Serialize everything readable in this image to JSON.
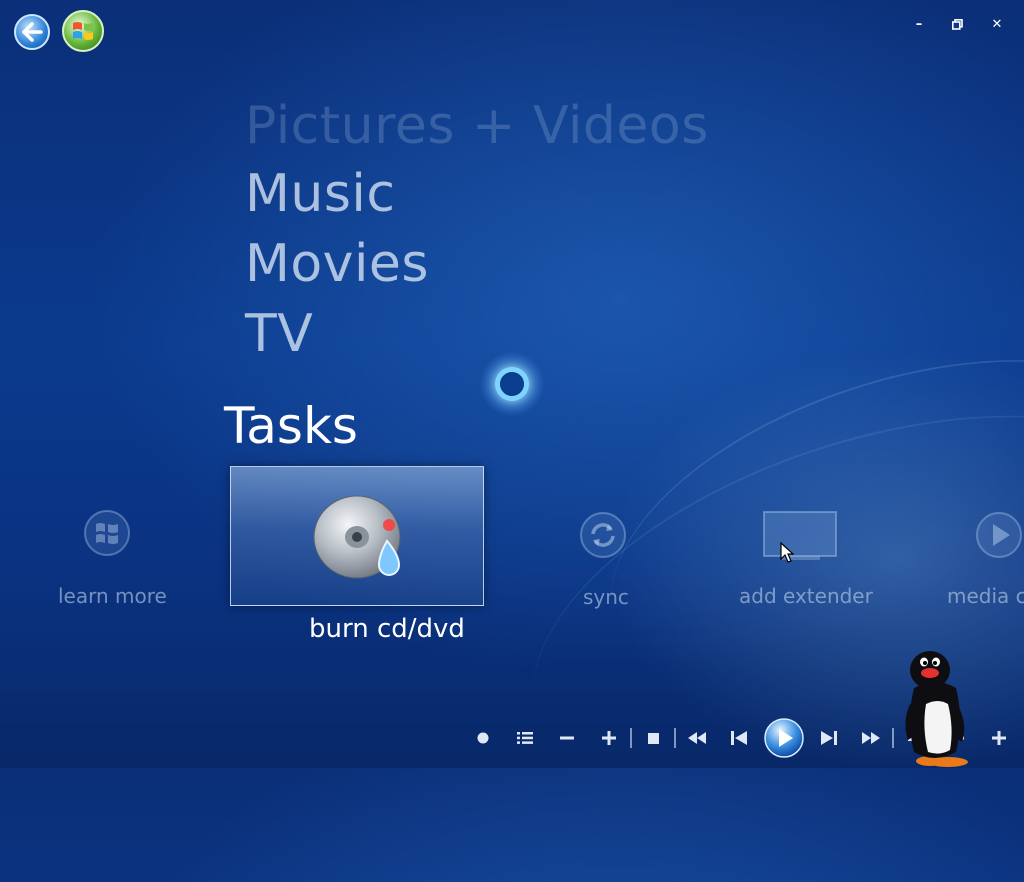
{
  "window": {
    "minimize_glyph": "–",
    "restore_glyph": "⧉",
    "close_glyph": "✕"
  },
  "nav": {
    "back_icon": "back-arrow-icon",
    "start_icon": "windows-start-icon"
  },
  "menu": {
    "items": [
      {
        "label": "Pictures + Videos"
      },
      {
        "label": "Music"
      },
      {
        "label": "Movies"
      },
      {
        "label": "TV"
      }
    ],
    "current_category": "Tasks"
  },
  "tasks": {
    "items": [
      {
        "label": "learn more",
        "icon": "windows-logo-icon"
      },
      {
        "label": "burn cd/dvd",
        "icon": "burn-disc-icon",
        "selected": true
      },
      {
        "label": "sync",
        "icon": "sync-icon"
      },
      {
        "label": "add extender",
        "icon": "extender-screen-icon"
      },
      {
        "label": "media c",
        "icon": "media-play-icon"
      }
    ]
  },
  "transport": {
    "buttons": [
      "record",
      "guide",
      "volume-down",
      "volume-up",
      "stop",
      "rewind",
      "previous",
      "play",
      "next",
      "fast-forward",
      "mute",
      "volume-down-2",
      "volume-up-2"
    ]
  },
  "colors": {
    "background": "#0b3a8d",
    "accent": "#7fd4ff",
    "text_dim": "#bed2eb"
  }
}
